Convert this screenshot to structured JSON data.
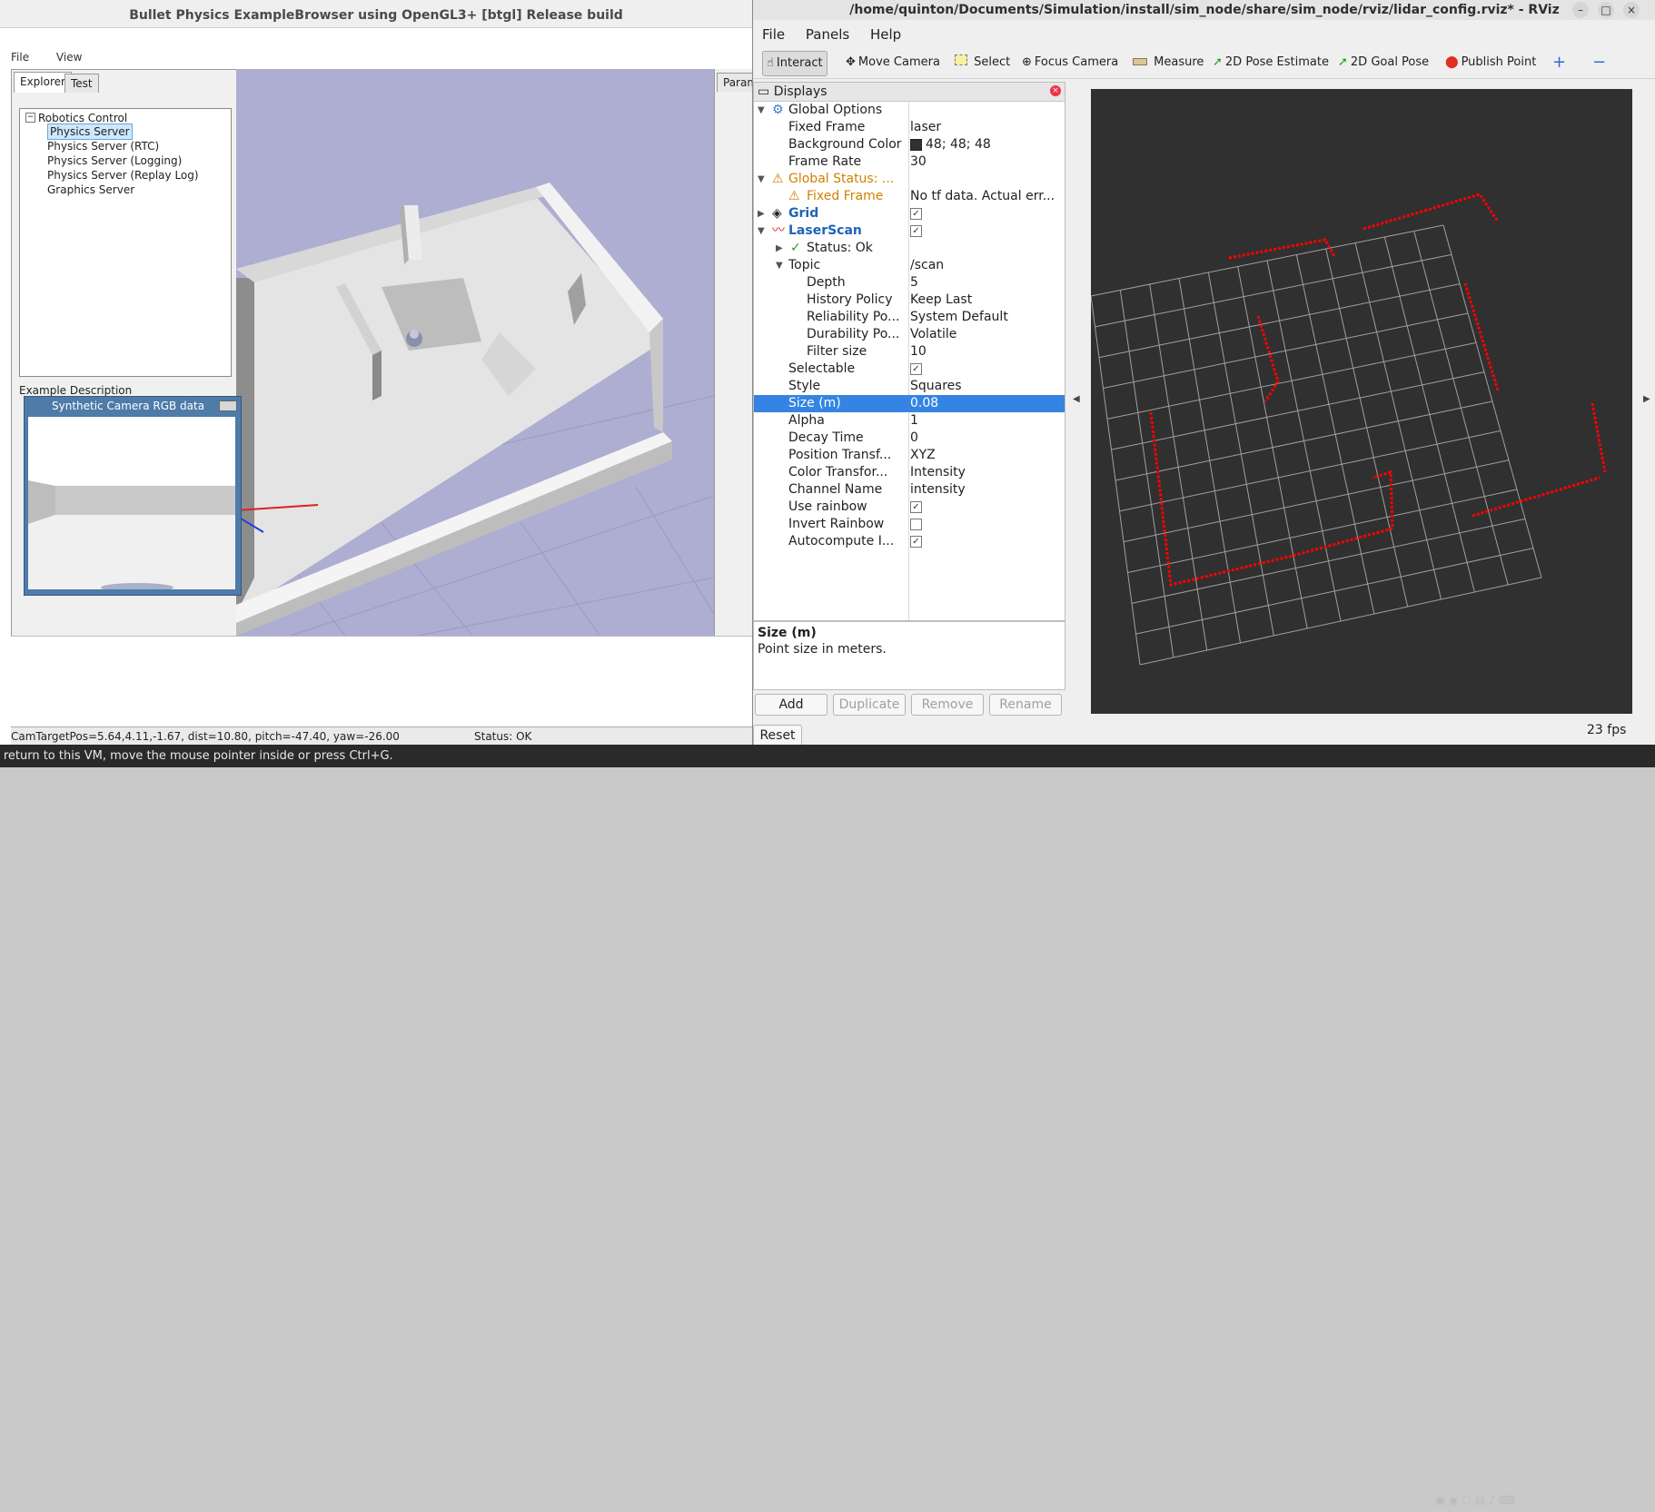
{
  "bullet": {
    "title": "Bullet Physics ExampleBrowser using OpenGL3+ [btgl] Release build",
    "menu": [
      "File",
      "View"
    ],
    "tabs": [
      "Explorer",
      "Test"
    ],
    "tree_root": "Robotics Control",
    "tree_items": [
      "Physics Server",
      "Physics Server (RTC)",
      "Physics Server (Logging)",
      "Physics Server (Replay Log)",
      "Graphics Server"
    ],
    "selected_item": "Physics Server",
    "example_description": "Example Description",
    "params_tab": "Params",
    "camera_window_title": "Synthetic Camera RGB data",
    "status_left": "CamTargetPos=5.64,4.11,-1.67, dist=10.80, pitch=-47.40, yaw=-26.00",
    "status_right": "Status: OK"
  },
  "vm_hint": "To return to this VM, move the mouse pointer inside or press Ctrl+G.",
  "rviz": {
    "title": "/home/quinton/Documents/Simulation/install/sim_node/share/sim_node/rviz/lidar_config.rviz* - RViz",
    "menu": [
      "File",
      "Panels",
      "Help"
    ],
    "tools": [
      {
        "label": "Interact",
        "icon": "cursor-icon"
      },
      {
        "label": "Move Camera",
        "icon": "move-camera-icon"
      },
      {
        "label": "Select",
        "icon": "select-icon"
      },
      {
        "label": "Focus Camera",
        "icon": "focus-icon"
      },
      {
        "label": "Measure",
        "icon": "ruler-icon"
      },
      {
        "label": "2D Pose Estimate",
        "icon": "pose-arrow-icon"
      },
      {
        "label": "2D Goal Pose",
        "icon": "goal-arrow-icon"
      },
      {
        "label": "Publish Point",
        "icon": "pin-icon"
      }
    ],
    "displays_title": "Displays",
    "properties": {
      "global_options": "Global Options",
      "fixed_frame": {
        "name": "Fixed Frame",
        "value": "laser"
      },
      "background_color": {
        "name": "Background Color",
        "value": "48; 48; 48"
      },
      "frame_rate": {
        "name": "Frame Rate",
        "value": "30"
      },
      "global_status": "Global Status: ...",
      "status_fixed_frame": {
        "name": "Fixed Frame",
        "value": "No tf data.  Actual err..."
      },
      "grid": "Grid",
      "laserscan": "LaserScan",
      "status_ok": "Status: Ok",
      "topic": {
        "name": "Topic",
        "value": "/scan"
      },
      "depth": {
        "name": "Depth",
        "value": "5"
      },
      "history_policy": {
        "name": "History Policy",
        "value": "Keep Last"
      },
      "reliability": {
        "name": "Reliability Po...",
        "value": "System Default"
      },
      "durability": {
        "name": "Durability Po...",
        "value": "Volatile"
      },
      "filter_size": {
        "name": "Filter size",
        "value": "10"
      },
      "selectable": {
        "name": "Selectable"
      },
      "style": {
        "name": "Style",
        "value": "Squares"
      },
      "size": {
        "name": "Size (m)",
        "value": "0.08"
      },
      "alpha": {
        "name": "Alpha",
        "value": "1"
      },
      "decay_time": {
        "name": "Decay Time",
        "value": "0"
      },
      "position_transform": {
        "name": "Position Transf...",
        "value": "XYZ"
      },
      "color_transform": {
        "name": "Color Transfor...",
        "value": "Intensity"
      },
      "channel_name": {
        "name": "Channel Name",
        "value": "intensity"
      },
      "use_rainbow": {
        "name": "Use rainbow"
      },
      "invert_rainbow": {
        "name": "Invert Rainbow"
      },
      "autocompute": {
        "name": "Autocompute I..."
      }
    },
    "description": {
      "title": "Size (m)",
      "text": "Point size in meters."
    },
    "buttons": {
      "add": "Add",
      "duplicate": "Duplicate",
      "remove": "Remove",
      "rename": "Rename",
      "reset": "Reset"
    },
    "fps": "23 fps",
    "colors": {
      "background": "#303030",
      "scan": "#ff0000",
      "grid": "#a0a0a0",
      "selection": "#3584e4"
    }
  }
}
